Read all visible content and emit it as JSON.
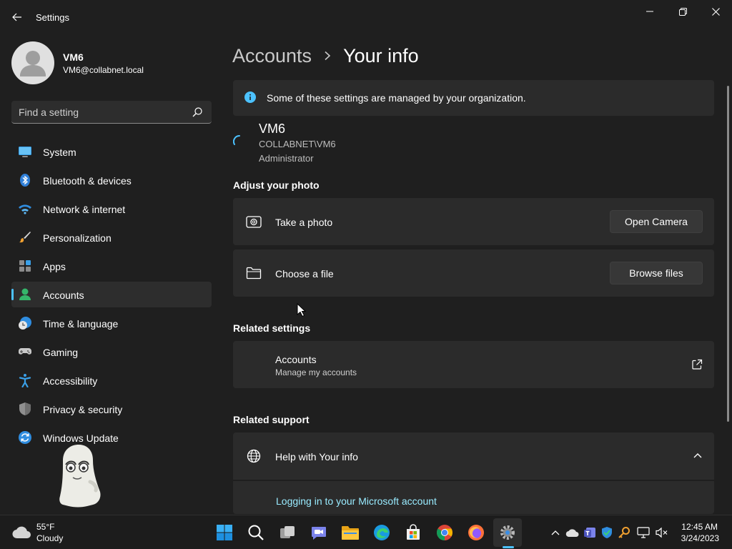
{
  "window": {
    "title": "Settings",
    "controls": [
      "minimize",
      "restore",
      "close"
    ]
  },
  "profile": {
    "name": "VM6",
    "email": "VM6@collabnet.local"
  },
  "search": {
    "placeholder": "Find a setting",
    "value": ""
  },
  "sidebar": {
    "items": [
      {
        "label": "System",
        "icon": "system-icon",
        "active": false
      },
      {
        "label": "Bluetooth & devices",
        "icon": "bluetooth-icon",
        "active": false
      },
      {
        "label": "Network & internet",
        "icon": "wifi-icon",
        "active": false
      },
      {
        "label": "Personalization",
        "icon": "brush-icon",
        "active": false
      },
      {
        "label": "Apps",
        "icon": "apps-icon",
        "active": false
      },
      {
        "label": "Accounts",
        "icon": "accounts-icon",
        "active": true
      },
      {
        "label": "Time & language",
        "icon": "clock-globe-icon",
        "active": false
      },
      {
        "label": "Gaming",
        "icon": "gamepad-icon",
        "active": false
      },
      {
        "label": "Accessibility",
        "icon": "accessibility-icon",
        "active": false
      },
      {
        "label": "Privacy & security",
        "icon": "shield-icon",
        "active": false
      },
      {
        "label": "Windows Update",
        "icon": "update-icon",
        "active": false
      }
    ]
  },
  "breadcrumb": {
    "parent": "Accounts",
    "current": "Your info"
  },
  "info_banner": {
    "text": "Some of these settings are managed by your organization."
  },
  "user": {
    "name": "VM6",
    "domain": "COLLABNET\\VM6",
    "role": "Administrator"
  },
  "adjust_photo": {
    "title": "Adjust your photo",
    "take_photo": {
      "label": "Take a photo",
      "button": "Open Camera"
    },
    "choose_file": {
      "label": "Choose a file",
      "button": "Browse files"
    }
  },
  "related_settings": {
    "title": "Related settings",
    "accounts": {
      "label": "Accounts",
      "sublabel": "Manage my accounts"
    }
  },
  "related_support": {
    "title": "Related support",
    "help": {
      "label": "Help with Your info",
      "expanded": true
    },
    "links": [
      "Logging in to your Microsoft account"
    ]
  },
  "taskbar": {
    "weather": {
      "temp": "55°F",
      "condition": "Cloudy"
    },
    "apps": [
      "start",
      "search",
      "task-view",
      "teams-chat",
      "file-explorer",
      "edge",
      "microsoft-store",
      "chrome",
      "firefox",
      "settings"
    ],
    "active_app": "settings",
    "clock": {
      "time": "12:45 AM",
      "date": "3/24/2023"
    }
  },
  "colors": {
    "background": "#1f1f1f",
    "card": "#2b2b2b",
    "accent": "#4cc2ff",
    "link": "#99ebff"
  }
}
